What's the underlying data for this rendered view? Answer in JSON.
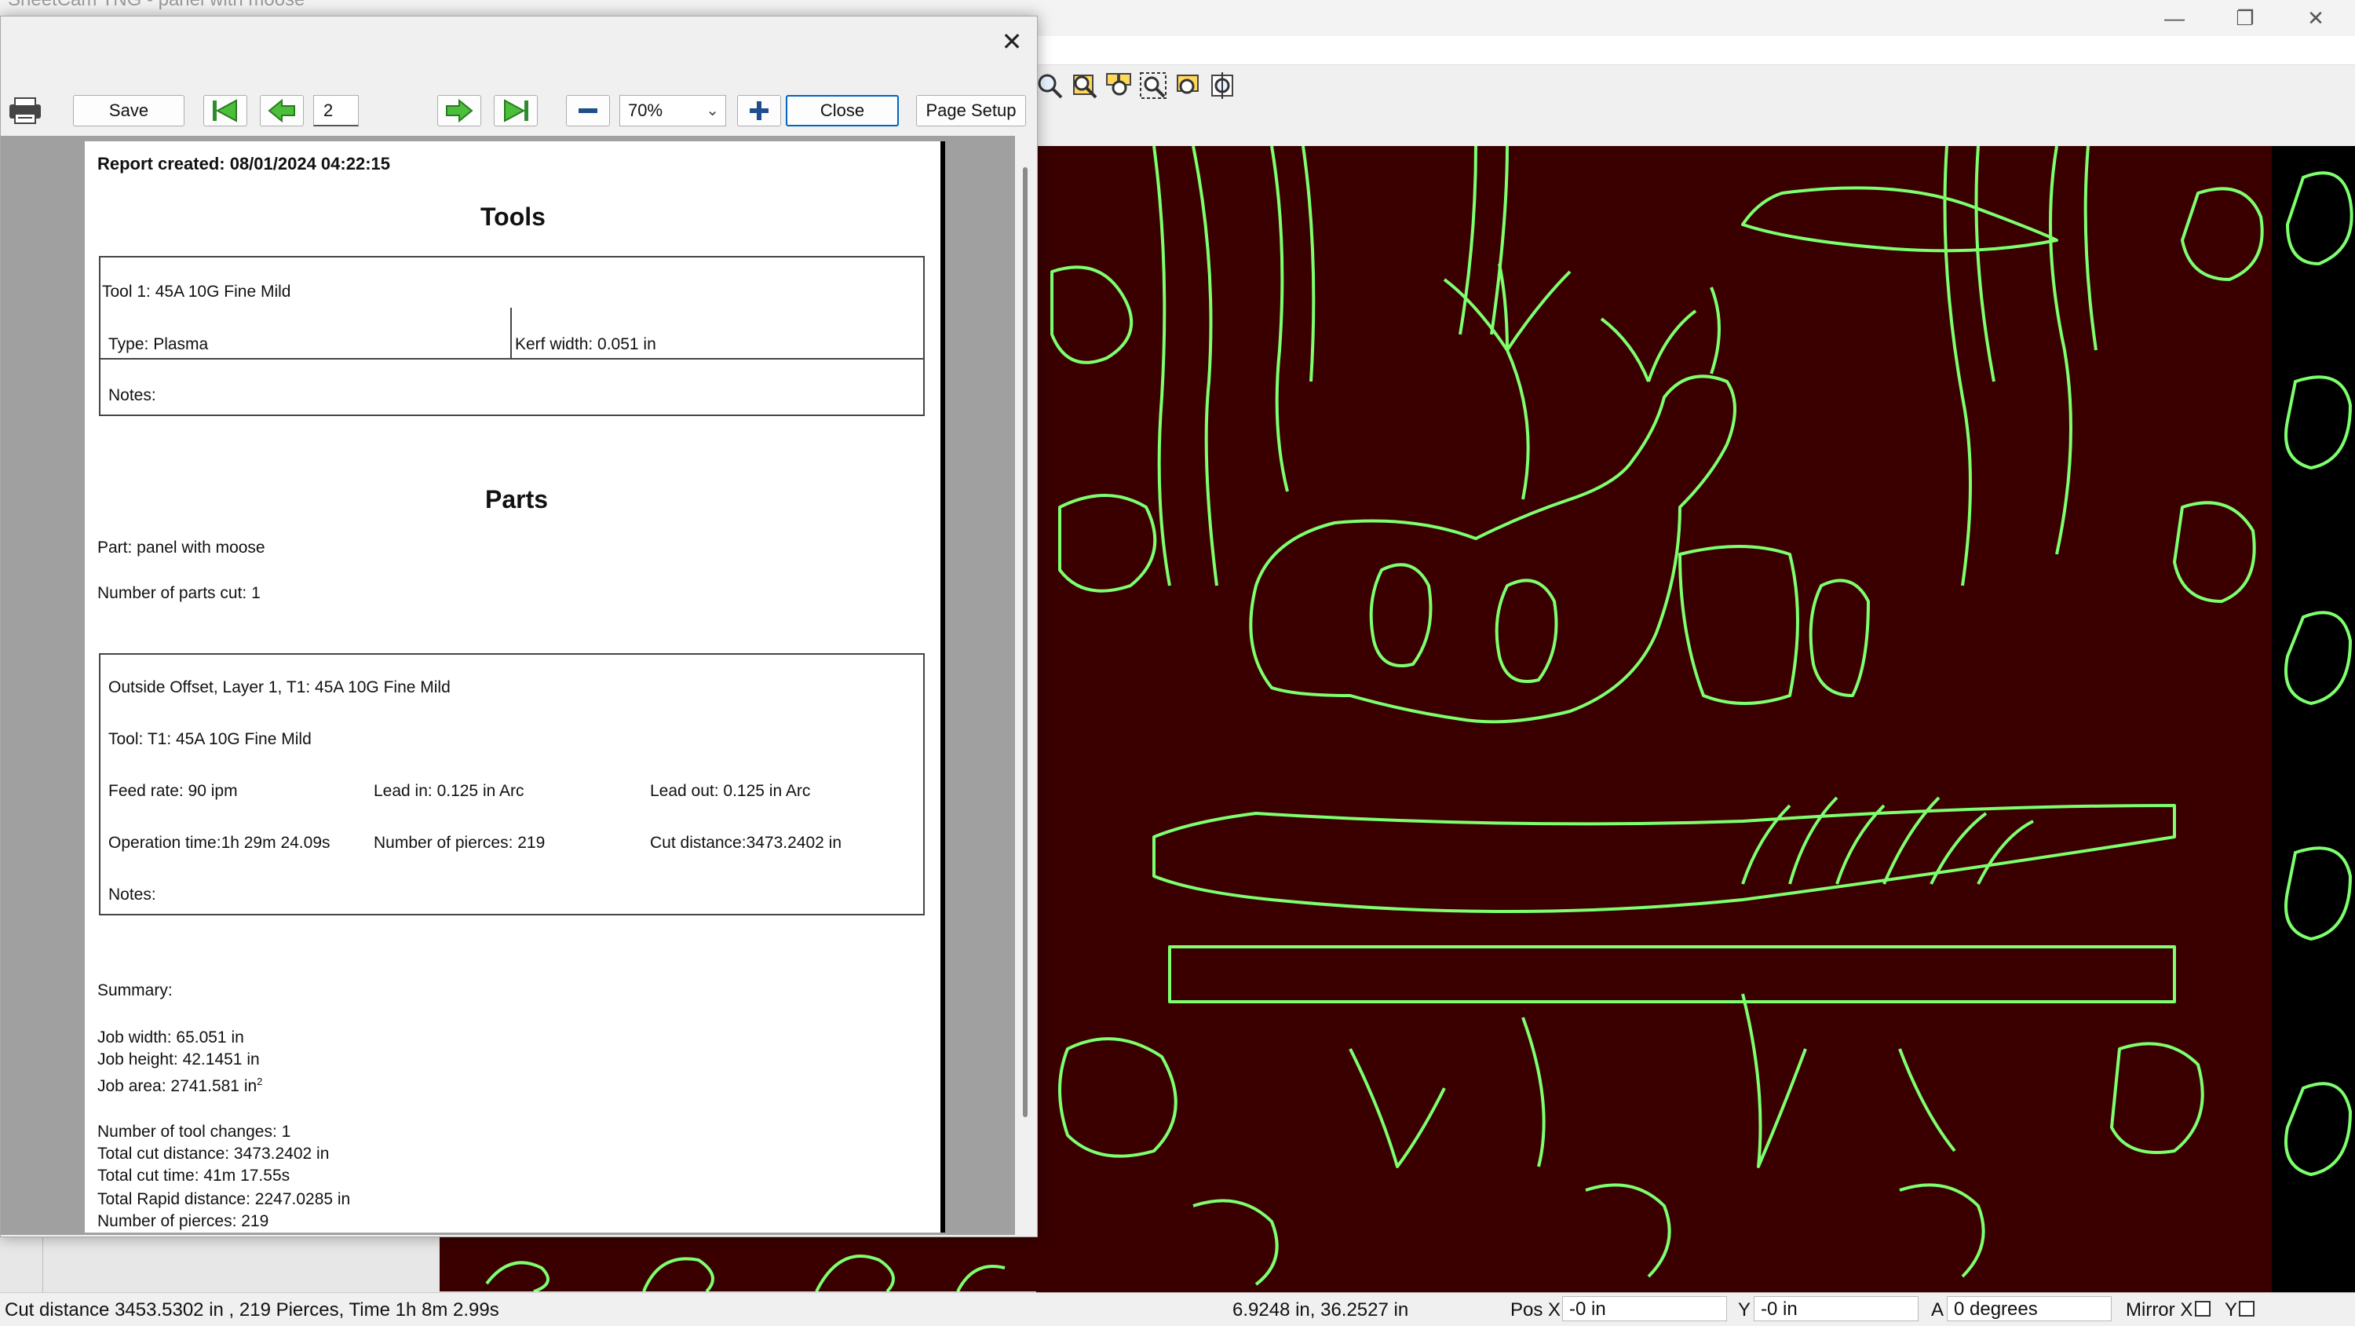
{
  "window": {
    "ghost_title": "SheetCam TNG - panel with moose",
    "minimize_glyph": "—",
    "maximize_glyph": "❐",
    "close_glyph": "✕"
  },
  "statusbar": {
    "cut_info": "Cut distance 3453.5302 in , 219 Pierces, Time 1h 8m 2.99s",
    "cursor_pos": "6.9248 in, 36.2527 in",
    "pos_x_label": "Pos X",
    "pos_x_value": "-0 in",
    "y_label": "Y",
    "y_value": "-0 in",
    "a_label": "A",
    "a_value": "0 degrees",
    "mirror_x_label": "Mirror X",
    "mirror_y_label": "Y"
  },
  "preview": {
    "dialog_close_glyph": "✕",
    "toolbar": {
      "save_label": "Save",
      "page_number": "2",
      "zoom_value": "70%",
      "zoom_arrow": "⌄",
      "close_label": "Close",
      "page_setup_label": "Page Setup"
    },
    "report": {
      "created": "Report created: 08/01/2024 04:22:15",
      "tools_heading": "Tools",
      "tool_name": "Tool 1: 45A 10G Fine Mild",
      "tool_type": "Type: Plasma",
      "kerf": "Kerf width: 0.051 in",
      "tool_notes": "Notes:",
      "parts_heading": "Parts",
      "part_name": "Part: panel with moose",
      "parts_cut": "Number of parts cut: 1",
      "op_name": "Outside Offset, Layer 1, T1: 45A 10G Fine Mild",
      "op_tool": "Tool: T1: 45A 10G Fine Mild",
      "feed_rate": "Feed rate: 90 ipm",
      "lead_in": "Lead in: 0.125 in Arc",
      "lead_out": "Lead out: 0.125 in Arc",
      "op_time": "Operation time:1h 29m 24.09s",
      "pierces": "Number of pierces: 219",
      "cut_distance": "Cut distance:3473.2402 in",
      "op_notes": "Notes:",
      "summary_label": "Summary:",
      "job_width": "Job width: 65.051 in",
      "job_height": "Job height: 42.1451 in",
      "job_area": "Job area: 2741.581 in",
      "job_area_sup": "2",
      "tool_changes": "Number of tool changes: 1",
      "total_cut_distance": "Total cut distance: 3473.2402 in",
      "total_cut_time": "Total cut time: 41m 17.55s",
      "total_rapid": "Total Rapid distance: 2247.0285 in",
      "total_pierces": "Number of pierces: 219"
    }
  },
  "colors": {
    "canvas_bg": "#3a0000",
    "cut_line": "#7dff6e",
    "accent": "#0067c0"
  }
}
